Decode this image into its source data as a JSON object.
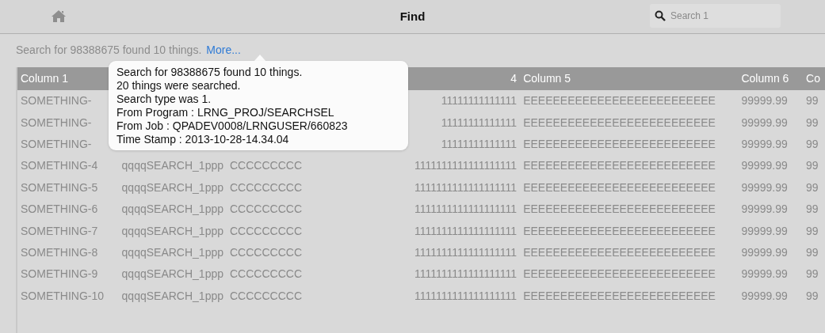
{
  "topbar": {
    "title": "Find",
    "search": {
      "placeholder": "Search 1"
    }
  },
  "summary": {
    "text": "Search for 98388675 found 10 things.",
    "link": "More..."
  },
  "popover": {
    "lines": [
      "Search for 98388675 found 10 things.",
      "20 things were searched.",
      "Search type was 1.",
      "From Program : LRNG_PROJ/SEARCHSEL",
      "From Job : QPADEV0008/LRNGUSER/660823",
      "Time Stamp : 2013-10-28-14.34.04"
    ]
  },
  "table": {
    "columns": [
      "Column 1",
      null,
      null,
      "4",
      "Column 5",
      "Column 6",
      "Co"
    ],
    "rows": [
      [
        "SOMETHING-",
        null,
        null,
        "11111111111111",
        "EEEEEEEEEEEEEEEEEEEEEEEEEE",
        "99999.99",
        "99"
      ],
      [
        "SOMETHING-",
        null,
        null,
        "11111111111111",
        "EEEEEEEEEEEEEEEEEEEEEEEEEE",
        "99999.99",
        "99"
      ],
      [
        "SOMETHING-",
        null,
        null,
        "11111111111111",
        "EEEEEEEEEEEEEEEEEEEEEEEEEE",
        "99999.99",
        "99"
      ],
      [
        "SOMETHING-4",
        "qqqqSEARCH_1ppp",
        "CCCCCCCCC",
        "1111111111111111111",
        "EEEEEEEEEEEEEEEEEEEEEEEEEE",
        "99999.99",
        "99"
      ],
      [
        "SOMETHING-5",
        "qqqqSEARCH_1ppp",
        "CCCCCCCCC",
        "1111111111111111111",
        "EEEEEEEEEEEEEEEEEEEEEEEEEE",
        "99999.99",
        "99"
      ],
      [
        "SOMETHING-6",
        "qqqqSEARCH_1ppp",
        "CCCCCCCCC",
        "1111111111111111111",
        "EEEEEEEEEEEEEEEEEEEEEEEEEE",
        "99999.99",
        "99"
      ],
      [
        "SOMETHING-7",
        "qqqqSEARCH_1ppp",
        "CCCCCCCCC",
        "1111111111111111111",
        "EEEEEEEEEEEEEEEEEEEEEEEEEE",
        "99999.99",
        "99"
      ],
      [
        "SOMETHING-8",
        "qqqqSEARCH_1ppp",
        "CCCCCCCCC",
        "1111111111111111111",
        "EEEEEEEEEEEEEEEEEEEEEEEEEE",
        "99999.99",
        "99"
      ],
      [
        "SOMETHING-9",
        "qqqqSEARCH_1ppp",
        "CCCCCCCCC",
        "1111111111111111111",
        "EEEEEEEEEEEEEEEEEEEEEEEEEE",
        "99999.99",
        "99"
      ],
      [
        "SOMETHING-10",
        "qqqqSEARCH_1ppp",
        "CCCCCCCCC",
        "1111111111111111111",
        "EEEEEEEEEEEEEEEEEEEEEEEEEE",
        "99999.99",
        "99"
      ]
    ]
  }
}
